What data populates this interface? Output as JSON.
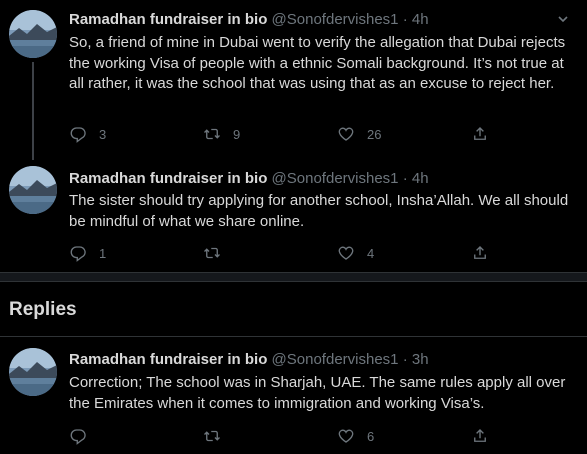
{
  "tweets": [
    {
      "name": "Ramadhan fundraiser in bio",
      "handle": "@Sonofdervishes1",
      "time": "· 4h",
      "text": "So, a friend of mine in Dubai went to verify the allegation that Dubai rejects the working Visa of people with a ethnic Somali background. It’s not true at all rather, it was the school that was using that as an excuse to reject her.",
      "replies": "3",
      "retweets": "9",
      "likes": "26"
    },
    {
      "name": "Ramadhan fundraiser in bio",
      "handle": "@Sonofdervishes1",
      "time": "· 4h",
      "text": "The sister should try applying for another school, Insha’Allah. We all should be mindful of what we share online.",
      "replies": "1",
      "retweets": "",
      "likes": "4"
    },
    {
      "name": "Ramadhan fundraiser in bio",
      "handle": "@Sonofdervishes1",
      "time": "· 3h",
      "text": "Correction; The school was in Sharjah, UAE. The same rules apply all over the Emirates when it comes to immigration and working Visa’s.",
      "replies": "",
      "retweets": "",
      "likes": "6"
    }
  ],
  "section_title": "Replies",
  "icons": {
    "reply": "reply-icon",
    "retweet": "retweet-icon",
    "like": "heart-icon",
    "share": "share-icon",
    "more": "chevron-down-icon"
  },
  "colors": {
    "background": "#000000",
    "text": "#d9d9d9",
    "muted": "#6e767d",
    "divider": "#2f3336"
  }
}
